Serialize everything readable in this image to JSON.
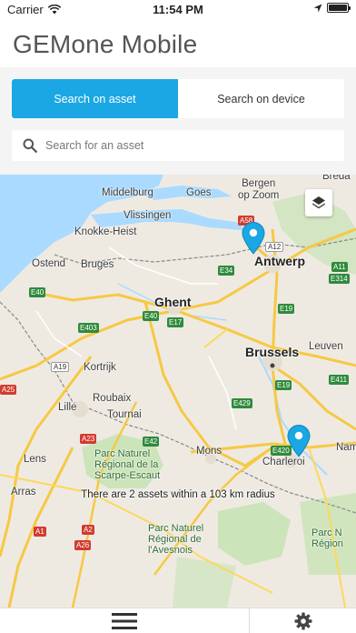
{
  "status_bar": {
    "carrier": "Carrier",
    "time": "11:54 PM"
  },
  "app": {
    "title": "GEMone Mobile"
  },
  "tabs": [
    {
      "label": "Search on asset",
      "active": true
    },
    {
      "label": "Search on device",
      "active": false
    }
  ],
  "search": {
    "placeholder": "Search for an asset",
    "value": ""
  },
  "map": {
    "places": {
      "breda": "Breda",
      "bergen_op_zoom": "Bergen\nop Zoom",
      "middelburg": "Middelburg",
      "goes": "Goes",
      "vlissingen": "Vlissingen",
      "knokke_heist": "Knokke-Heist",
      "ostend": "Ostend",
      "bruges": "Bruges",
      "antwerp": "Antwerp",
      "ghent": "Ghent",
      "brussels": "Brussels",
      "kortrijk": "Kortrijk",
      "leuven": "Leuven",
      "lille": "Lille",
      "roubaix": "Roubaix",
      "tournai": "Tournai",
      "lens": "Lens",
      "mons": "Mons",
      "charleroi": "Charleroi",
      "arras": "Arras",
      "nam": "Nam",
      "park_scarpe": "Parc Naturel\nRégional de la\nScarpe-Escaut",
      "park_avesnois": "Parc Naturel\nRégional de\nl'Avesnois",
      "park_right": "Parc N\nRégion"
    },
    "roads": {
      "a58": "A58",
      "a12": "A12",
      "e34": "E34",
      "a11": "A11",
      "e40a": "E40",
      "e40b": "E40",
      "e17": "E17",
      "e19a": "E19",
      "e19b": "E19",
      "e403": "E403",
      "a19": "A19",
      "a25": "A25",
      "e429": "E429",
      "a23": "A23",
      "e42": "E42",
      "e420": "E420",
      "a2": "A2",
      "a1": "A1",
      "a26": "A26",
      "e314": "E314",
      "e411": "E411"
    },
    "radius_text": "There are 2 assets within a 103 km radius",
    "colors": {
      "pin": "#1aa7e4",
      "sea": "#aadaff",
      "land": "#eeeae2",
      "road": "#fdd85c",
      "park": "#c8e3b5"
    }
  },
  "bottom_bar": {
    "menu_icon": "hamburger-menu-icon",
    "settings_icon": "gear-icon"
  }
}
